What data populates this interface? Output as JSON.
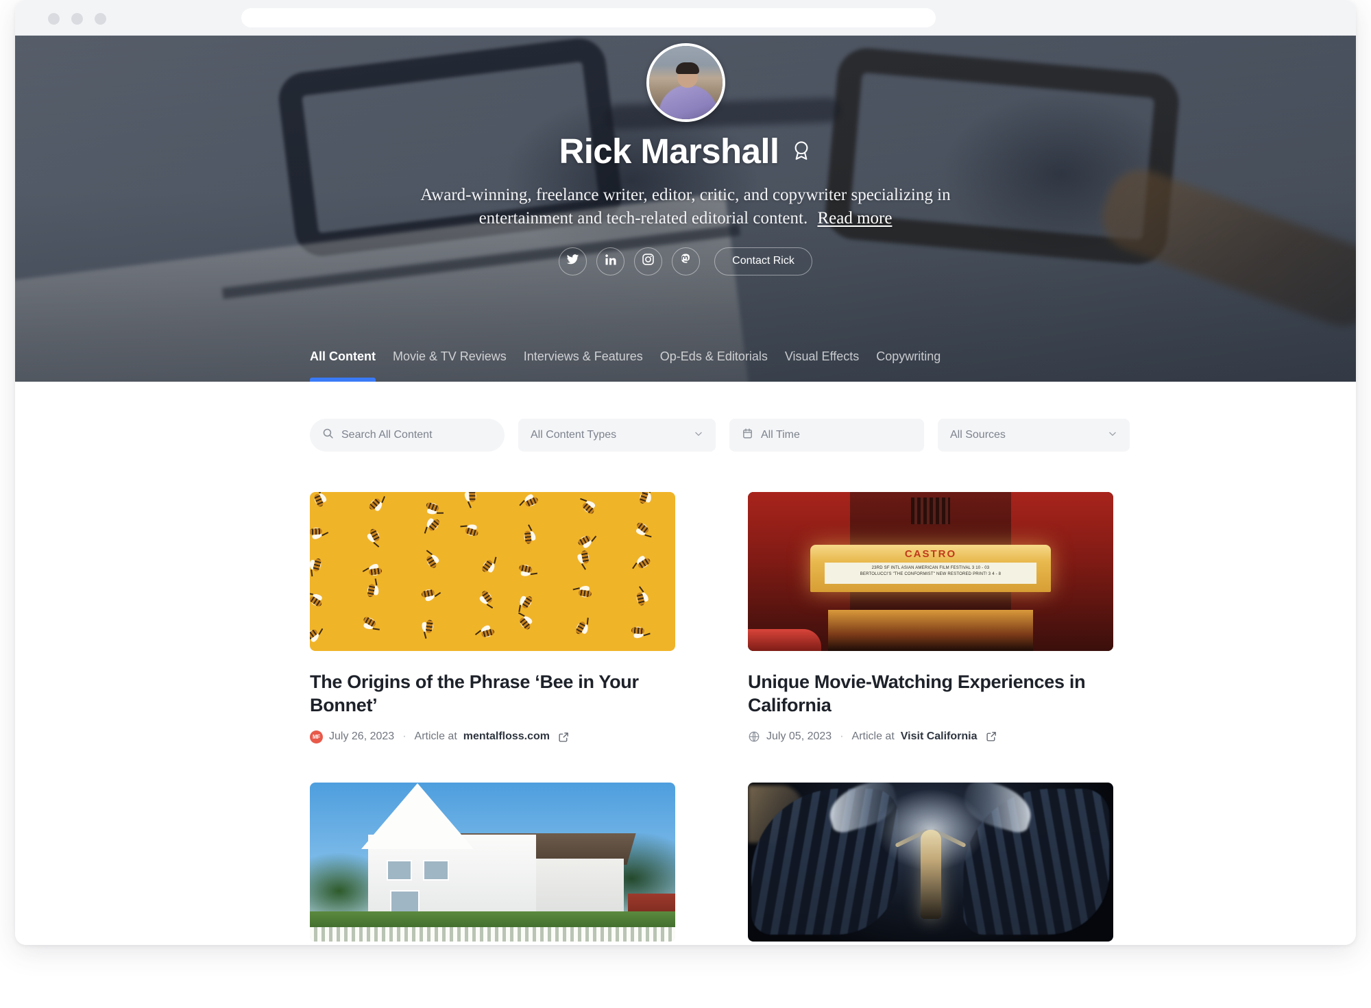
{
  "browser": {
    "url_value": "",
    "url_placeholder": "",
    "traffic_lights": [
      "close",
      "minimize",
      "maximize"
    ]
  },
  "hero": {
    "avatar_alt": "Rick Marshall profile photo",
    "name": "Rick Marshall",
    "verified_badge": "award-ribbon-icon",
    "tagline": "Award-winning, freelance writer, editor, critic, and copywriter specializing in entertainment and tech-related editorial content.",
    "read_more_label": "Read more",
    "social_links": [
      {
        "name": "twitter",
        "label": "Twitter"
      },
      {
        "name": "linkedin",
        "label": "LinkedIn"
      },
      {
        "name": "instagram",
        "label": "Instagram"
      },
      {
        "name": "mastodon",
        "label": "Mastodon"
      }
    ],
    "contact_button_label": "Contact Rick",
    "accent_color": "#3b7af7",
    "background_color": "#565f6b"
  },
  "tabs": [
    {
      "label": "All Content",
      "active": true
    },
    {
      "label": "Movie & TV Reviews",
      "active": false
    },
    {
      "label": "Interviews & Features",
      "active": false
    },
    {
      "label": "Op-Eds & Editorials",
      "active": false
    },
    {
      "label": "Visual Effects",
      "active": false
    },
    {
      "label": "Copywriting",
      "active": false
    }
  ],
  "filters": {
    "search": {
      "icon": "search-icon",
      "value": "",
      "placeholder": "Search All Content"
    },
    "content_type": {
      "value": "All Content Types",
      "icon": "chevron-down-icon"
    },
    "time": {
      "icon": "calendar-icon",
      "value": "All Time"
    },
    "sources": {
      "value": "All Sources",
      "icon": "chevron-down-icon"
    }
  },
  "cards": [
    {
      "title": "The Origins of the Phrase ‘Bee in Your Bonnet’",
      "date": "July 26, 2023",
      "separator": "·",
      "prefix": "Article at",
      "source": "mentalfloss.com",
      "favicon_type": "mentalfloss-favicon",
      "favicon_text": "MF",
      "favicon_color": "#e8594a",
      "external_link_icon": "external-link-icon",
      "thumb": "bee-pattern-illustration"
    },
    {
      "title": "Unique Movie-Watching Experiences in California",
      "date": "July 05, 2023",
      "separator": "·",
      "prefix": "Article at",
      "source": "Visit California",
      "favicon_type": "globe-icon",
      "favicon_text": "",
      "favicon_color": "#8a9099",
      "external_link_icon": "external-link-icon",
      "thumb": "castro-theatre-photo"
    },
    {
      "title": "",
      "date": "",
      "separator": "",
      "prefix": "",
      "source": "",
      "favicon_type": "",
      "favicon_text": "",
      "favicon_color": "",
      "external_link_icon": "",
      "thumb": "victorian-house-photo"
    },
    {
      "title": "",
      "date": "",
      "separator": "",
      "prefix": "",
      "source": "",
      "favicon_type": "",
      "favicon_text": "",
      "favicon_color": "",
      "external_link_icon": "",
      "thumb": "vfx-winged-figure-photo"
    }
  ],
  "castro_marquee": {
    "sign": "CASTRO",
    "line1": "23RD SF INTL ASIAN AMERICAN FILM FESTIVAL 3 10 - 03",
    "line2": "BERTOLUCCI'S \"THE CONFORMIST\" NEW RESTORED PRINT! 3 4 - 8"
  }
}
